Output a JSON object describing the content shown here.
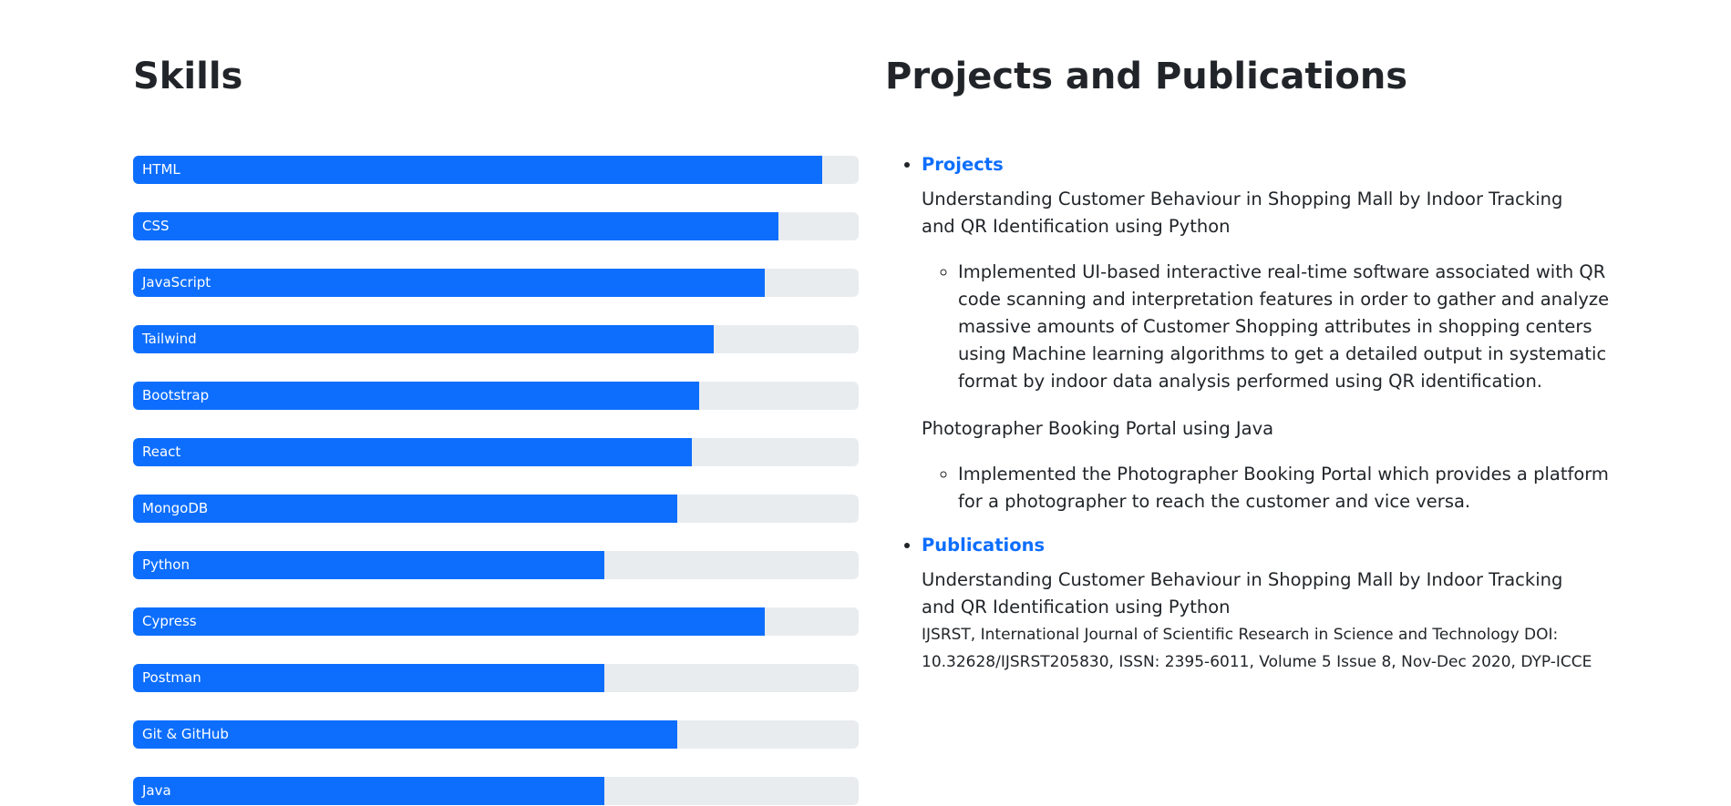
{
  "skills": {
    "title": "Skills",
    "items": [
      {
        "label": "HTML",
        "level": 95
      },
      {
        "label": "CSS",
        "level": 89
      },
      {
        "label": "JavaScript",
        "level": 87
      },
      {
        "label": "Tailwind",
        "level": 80
      },
      {
        "label": "Bootstrap",
        "level": 78
      },
      {
        "label": "React",
        "level": 77
      },
      {
        "label": "MongoDB",
        "level": 75
      },
      {
        "label": "Python",
        "level": 65
      },
      {
        "label": "Cypress",
        "level": 87
      },
      {
        "label": "Postman",
        "level": 65
      },
      {
        "label": "Git & GitHub",
        "level": 75
      },
      {
        "label": "Java",
        "level": 65
      }
    ],
    "colors": {
      "bar": "#0d6efd",
      "track": "#e9ecef"
    }
  },
  "projects_pubs": {
    "title": "Projects and Publications",
    "projects": {
      "label": "Projects",
      "items": [
        {
          "title": "Understanding Customer Behaviour in Shopping Mall by Indoor Tracking and QR Identification using Python",
          "detail": "Implemented UI-based interactive real-time software associated with QR code scanning and interpretation features in order to gather and analyze massive amounts of Customer Shopping attributes in shopping centers using Machine learning algorithms to get a detailed output in systematic format by indoor data analysis performed using QR identification."
        },
        {
          "title": "Photographer Booking Portal using Java",
          "detail": "Implemented the Photographer Booking Portal which provides a platform for a photographer to reach the customer and vice versa."
        }
      ]
    },
    "publications": {
      "label": "Publications",
      "title": "Understanding Customer Behaviour in Shopping Mall by Indoor Tracking and QR Identification using Python",
      "meta": "IJSRST, International Journal of Scientific Research in Science and Technology DOI: 10.32628/IJSRST205830, ISSN: 2395-6011, Volume 5 Issue 8, Nov-Dec 2020, DYP-ICCE"
    },
    "link_color": "#0d6efd"
  }
}
